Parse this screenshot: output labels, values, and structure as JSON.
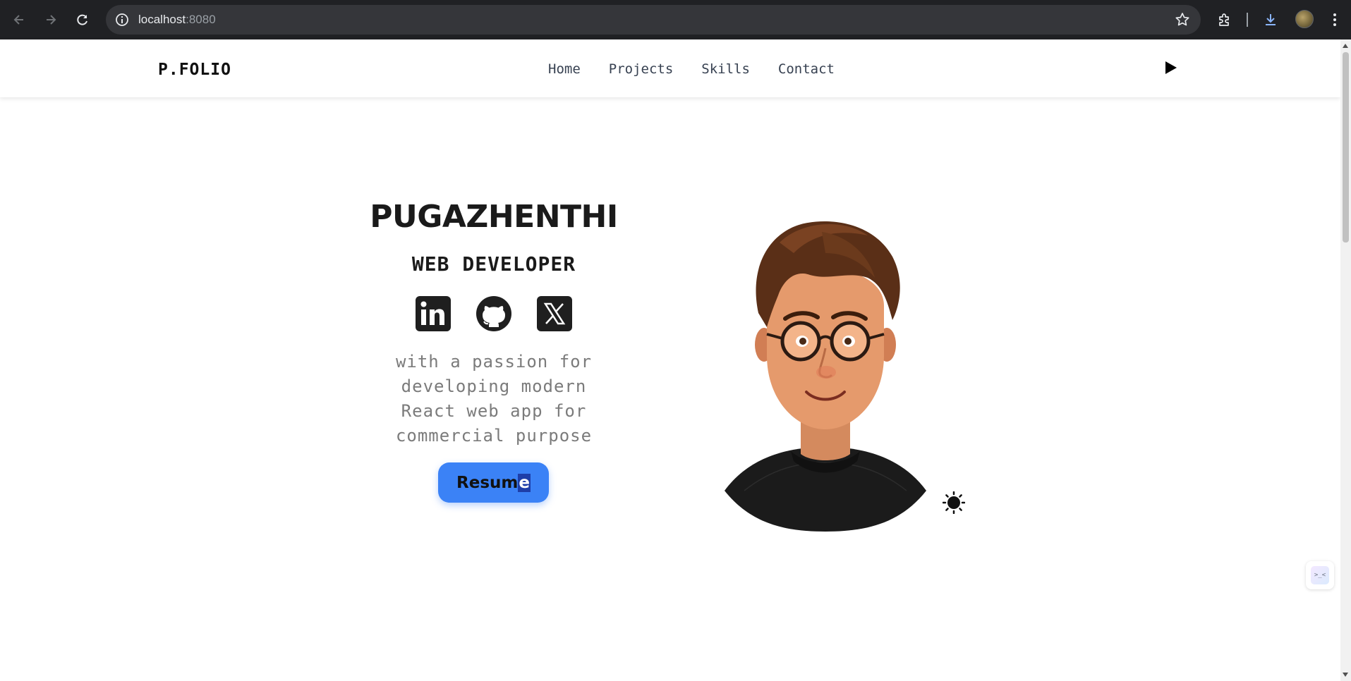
{
  "browser": {
    "url_host": "localhost",
    "url_port": ":8080",
    "icons": [
      "back-arrow-icon",
      "forward-arrow-icon",
      "reload-icon",
      "site-info-icon",
      "bookmark-star-icon",
      "extensions-icon",
      "download-icon",
      "profile-avatar",
      "kebab-menu-icon"
    ]
  },
  "navbar": {
    "brand": "P.FOLIO",
    "links": [
      "Home",
      "Projects",
      "Skills",
      "Contact"
    ],
    "play_icon": "play-icon"
  },
  "hero": {
    "name": "PUGAZHENTHI",
    "role": "WEB DEVELOPER",
    "socials": [
      "linkedin-icon",
      "github-icon",
      "x-twitter-icon"
    ],
    "tagline": [
      "with a passion for",
      "developing modern",
      "React web app for",
      "commercial purpose"
    ],
    "resume_label_main": "Resum",
    "resume_label_selected": "e",
    "theme_toggle_icon": "sun-icon"
  },
  "side_widget": {
    "text": ">_<"
  },
  "colors": {
    "accent": "#3b82f6",
    "chrome_bg": "#202124",
    "tagline_gray": "#7b7b7b",
    "text_dark": "#1a1a1a"
  }
}
